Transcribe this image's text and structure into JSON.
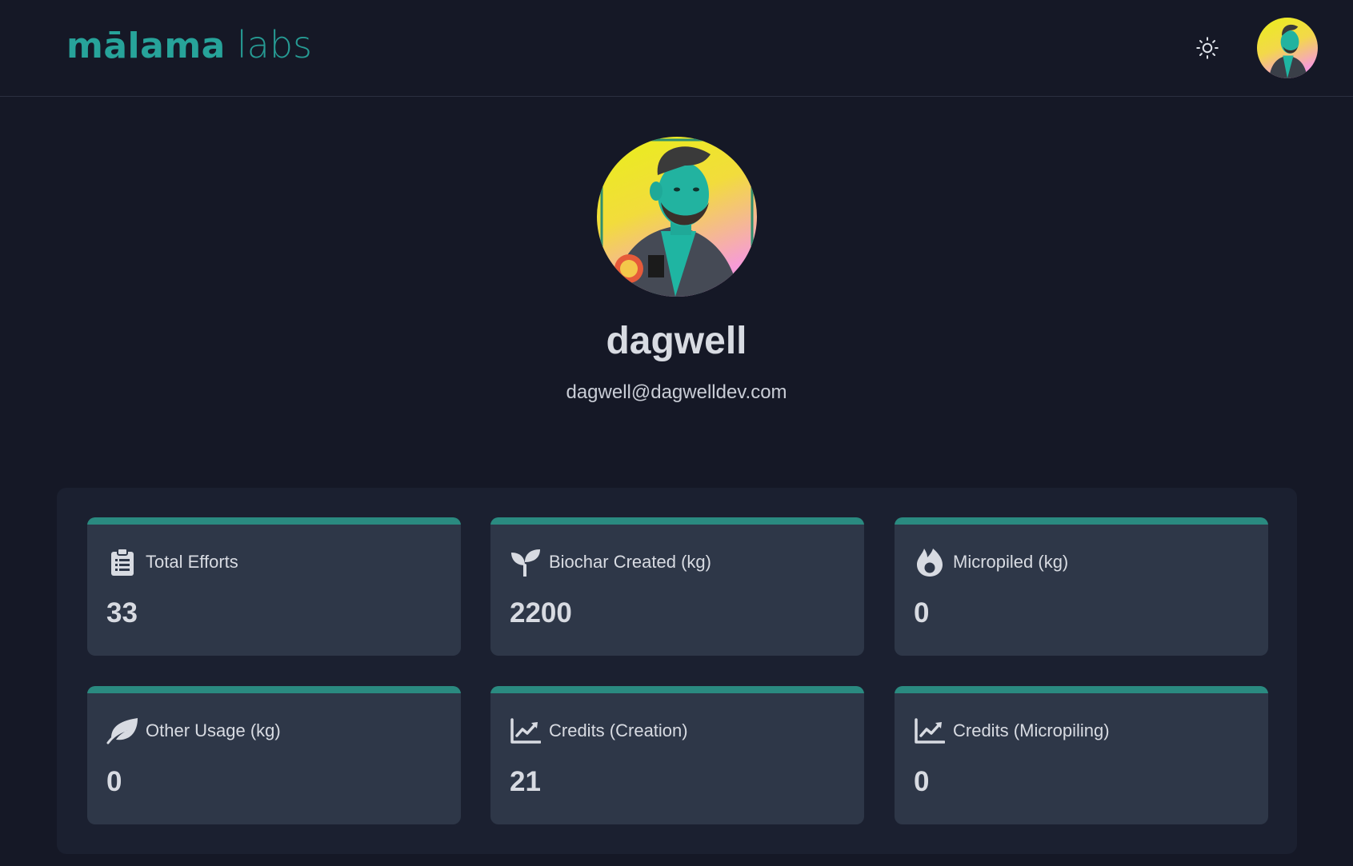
{
  "brand": {
    "logo_bold": "mālama",
    "logo_light": "labs",
    "accent_color": "#27a39a"
  },
  "header": {
    "theme_toggle_icon": "sun-icon",
    "avatar_icon": "user-avatar"
  },
  "profile": {
    "username": "dagwell",
    "email": "dagwell@dagwelldev.com"
  },
  "stats": [
    {
      "label": "Total Efforts",
      "value": "33",
      "icon": "clipboard-icon"
    },
    {
      "label": "Biochar Created (kg)",
      "value": "2200",
      "icon": "seedling-icon"
    },
    {
      "label": "Micropiled (kg)",
      "value": "0",
      "icon": "flame-icon"
    },
    {
      "label": "Other Usage (kg)",
      "value": "0",
      "icon": "leaf-icon"
    },
    {
      "label": "Credits (Creation)",
      "value": "21",
      "icon": "chart-line-icon"
    },
    {
      "label": "Credits (Micropiling)",
      "value": "0",
      "icon": "chart-line-icon"
    }
  ]
}
